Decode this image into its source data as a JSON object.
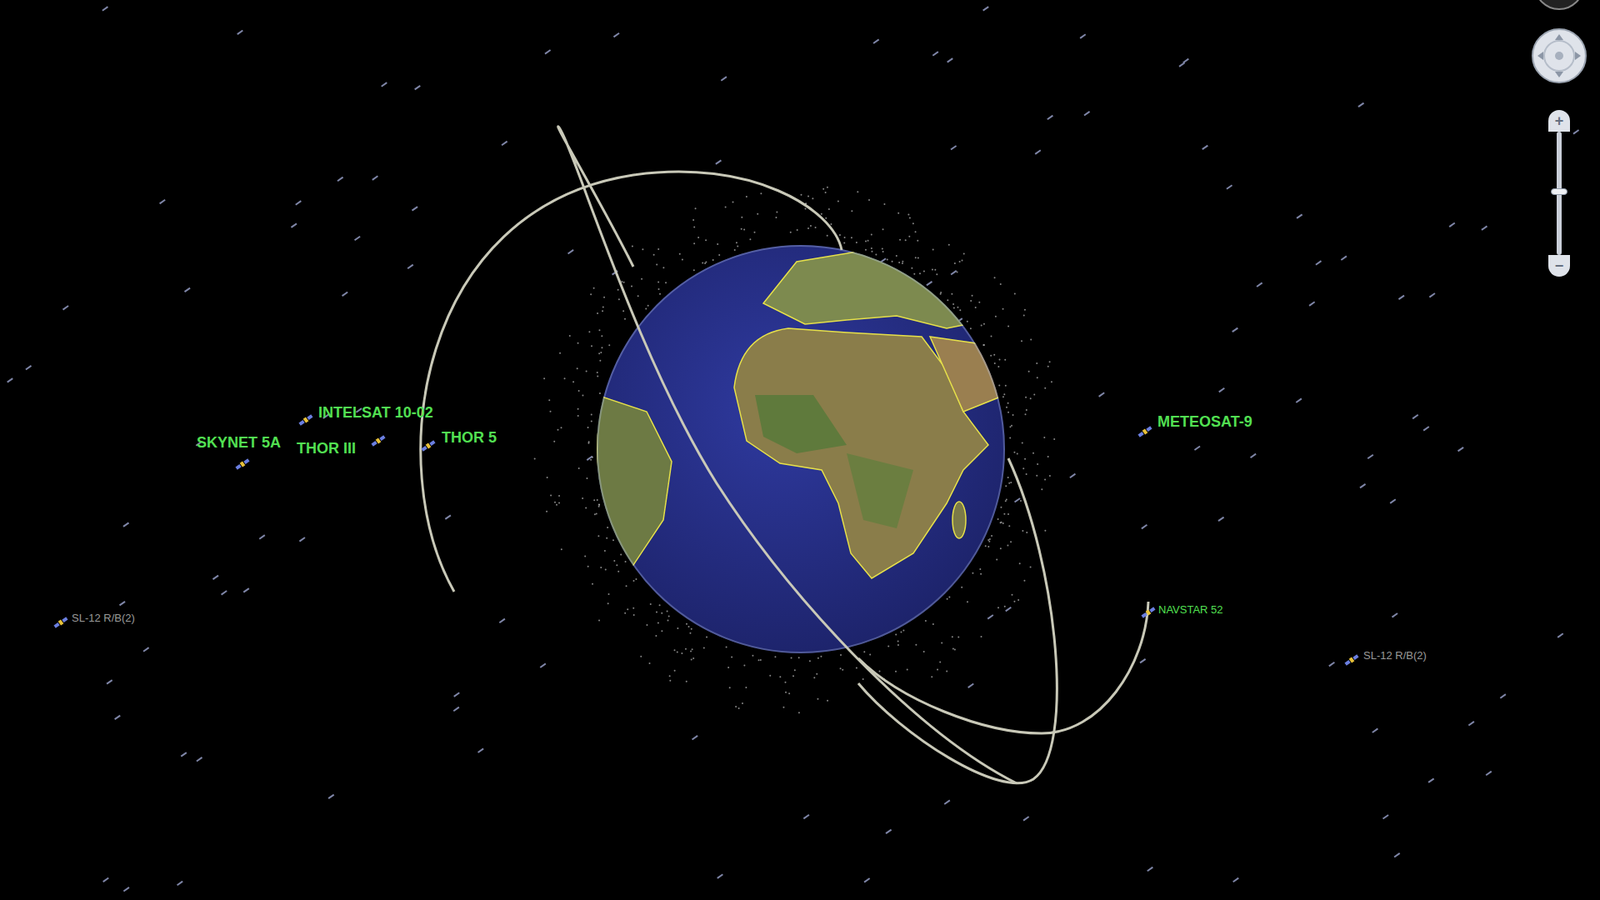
{
  "satellites": [
    {
      "name": "INTELSAT 10-02",
      "kind": "major",
      "color": "#52e052"
    },
    {
      "name": "SKYNET 5A",
      "kind": "major",
      "color": "#52e052"
    },
    {
      "name": "THOR III",
      "kind": "major",
      "color": "#52e052"
    },
    {
      "name": "THOR 5",
      "kind": "major",
      "color": "#52e052"
    },
    {
      "name": "METEOSAT-9",
      "kind": "major",
      "color": "#52e052"
    },
    {
      "name": "NAVSTAR 52",
      "kind": "minor",
      "color": "#52e052"
    },
    {
      "name": "SL-12 R/B(2)",
      "kind": "minor",
      "color": "#9a9a9a"
    },
    {
      "name": "SL-12 R/B(2)",
      "kind": "minor",
      "color": "#9a9a9a"
    }
  ],
  "controls": {
    "zoom": {
      "level": 0.5,
      "in": "+",
      "out": "−"
    }
  }
}
